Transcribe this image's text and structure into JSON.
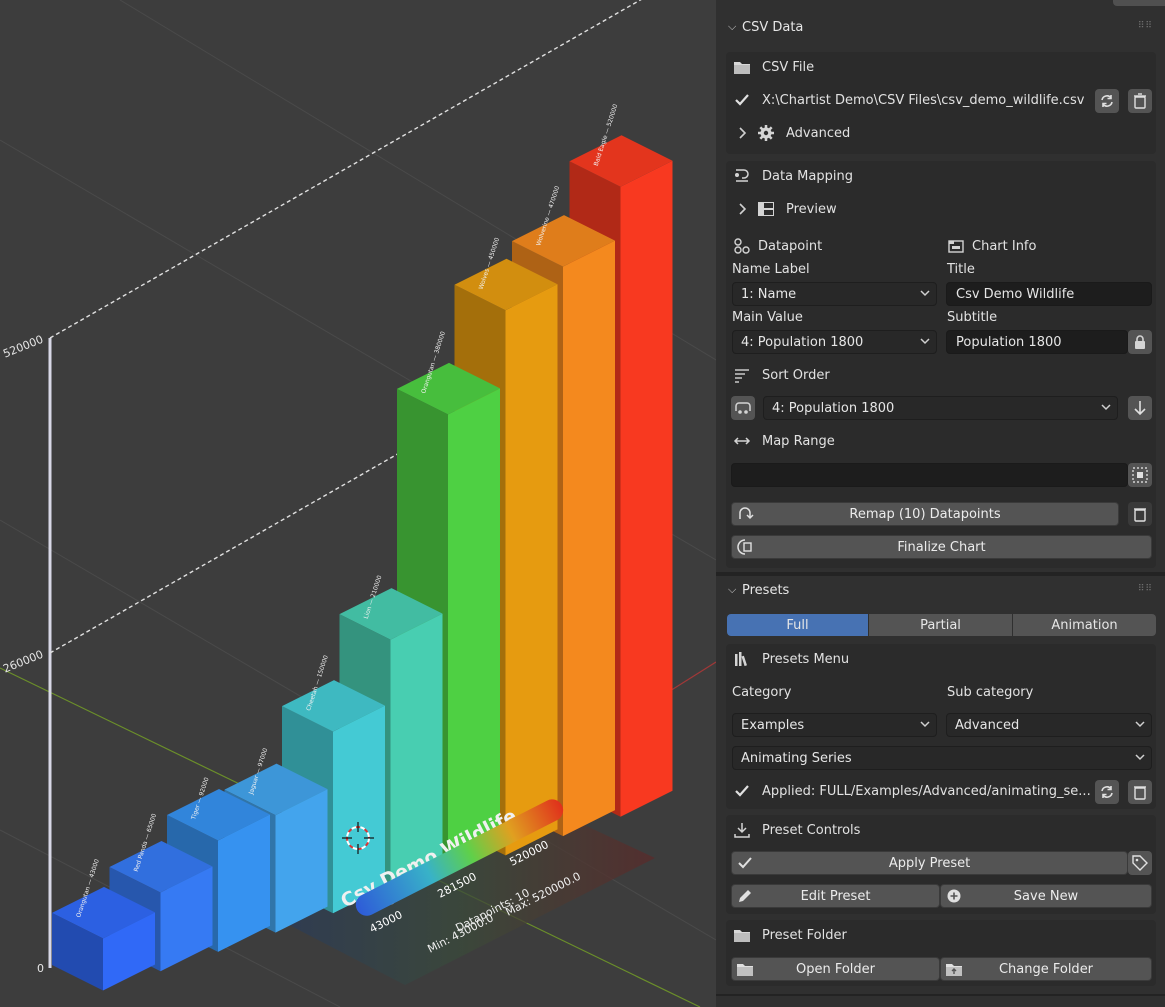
{
  "chart_data": {
    "type": "bar",
    "title": "Csv Demo Wildlife",
    "subtitle": "Population 1800",
    "categories": [
      "Orangutan",
      "Red Panda",
      "Tiger",
      "Jaguar",
      "Cheetah",
      "Lion",
      "Orangutan",
      "Wolves",
      "Wolverine",
      "Bald Eagle"
    ],
    "values": [
      43000,
      65000,
      92000,
      97000,
      150000,
      210000,
      380000,
      450000,
      470000,
      520000
    ],
    "bar_labels": [
      "Orangutan — 43000",
      "Red Panda — 65000",
      "Tiger — 92000",
      "Jaguar — 97000",
      "Cheetah — 150000",
      "Lion — 210000",
      "Orangutan — 380000",
      "Wolves — 450000",
      "Wolverine — 470000",
      "Bald Eagle — 520000"
    ],
    "colors": [
      "#2a5bd7",
      "#2f6ad3",
      "#2f7fd1",
      "#3a8fce",
      "#3bb0b8",
      "#3fb39a",
      "#44b53a",
      "#c8870e",
      "#d4771a",
      "#d8321c"
    ],
    "ylim": [
      0,
      520000
    ],
    "y_ticks": [
      "0",
      "260000",
      "520000"
    ],
    "legend": {
      "min_label": "43000",
      "mid_label": "281500",
      "max_label": "520000",
      "datapoints": "Datapoints: 10",
      "min_text": "Min: 43000.0",
      "max_text": "Max: 520000.0"
    }
  },
  "csv_data": {
    "header": "CSV Data",
    "csv_file_label": "CSV File",
    "file_path": "X:\\Chartist Demo\\CSV Files\\csv_demo_wildlife.csv",
    "advanced_label": "Advanced"
  },
  "data_mapping": {
    "header": "Data Mapping",
    "preview_label": "Preview",
    "datapoint_label": "Datapoint",
    "chart_info_label": "Chart Info",
    "name_label": "Name Label",
    "name_value": "1: Name",
    "title_label": "Title",
    "title_value": "Csv Demo Wildlife",
    "main_value_label": "Main Value",
    "main_value": "4: Population 1800",
    "subtitle_label": "Subtitle",
    "subtitle_value": "Population 1800",
    "sort_order_label": "Sort Order",
    "sort_value": "4: Population 1800",
    "map_range_label": "Map Range",
    "remap_button": "Remap (10) Datapoints",
    "finalize_button": "Finalize Chart"
  },
  "presets": {
    "header": "Presets",
    "tabs": [
      "Full",
      "Partial",
      "Animation"
    ],
    "active_tab": "Full",
    "menu_label": "Presets Menu",
    "category_label": "Category",
    "subcategory_label": "Sub category",
    "category_value": "Examples",
    "subcategory_value": "Advanced",
    "preset_value": "Animating Series",
    "applied_text": "Applied: FULL/Examples/Advanced/animating_se...",
    "controls_label": "Preset Controls",
    "apply_button": "Apply Preset",
    "edit_button": "Edit Preset",
    "save_button": "Save New",
    "folder_label": "Preset Folder",
    "open_folder_button": "Open Folder",
    "change_folder_button": "Change Folder"
  },
  "accent_color": "#4772b3"
}
